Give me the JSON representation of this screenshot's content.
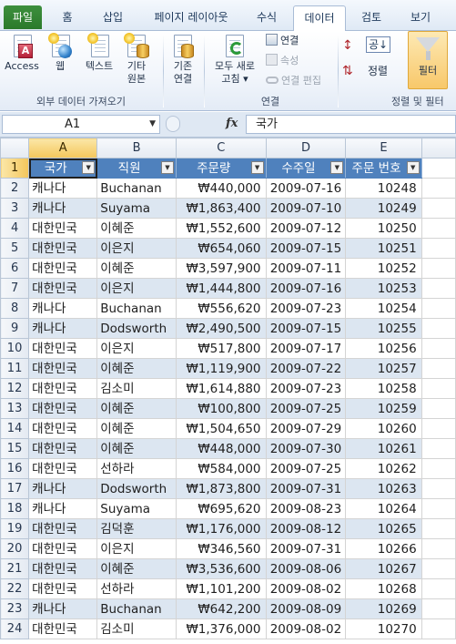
{
  "ribbon_tabs": [
    {
      "label": "파일"
    },
    {
      "label": "홈"
    },
    {
      "label": "삽입"
    },
    {
      "label": "페이지 레이아웃"
    },
    {
      "label": "수식"
    },
    {
      "label": "데이터"
    },
    {
      "label": "검토"
    },
    {
      "label": "보기"
    }
  ],
  "external_group": {
    "access": "Access",
    "web": "웹",
    "text": "텍스트",
    "other_line1": "기타",
    "other_line2": "원본",
    "label": "외부 데이터 가져오기"
  },
  "connections_group": {
    "existing_line1": "기존",
    "existing_line2": "연결",
    "refresh_line1": "모두 새로",
    "refresh_line2": "고침",
    "connections": "연결",
    "properties": "속성",
    "edit_links": "연결 편집",
    "label": "연결"
  },
  "sort_group": {
    "sort_az": "공↓",
    "sort": "정렬",
    "filter": "필터",
    "label": "정렬 및 필터"
  },
  "formula_bar": {
    "name_box": "A1",
    "fx": "fx",
    "formula": "국가"
  },
  "columns": [
    "A",
    "B",
    "C",
    "D",
    "E"
  ],
  "header_row": {
    "number": "1",
    "cells": [
      "국가",
      "직원",
      "주문량",
      "수주일",
      "주문 번호"
    ]
  },
  "rows": [
    {
      "n": "2",
      "c": [
        "캐나다",
        "Buchanan",
        "₩440,000",
        "2009-07-16",
        "10248"
      ]
    },
    {
      "n": "3",
      "c": [
        "캐나다",
        "Suyama",
        "₩1,863,400",
        "2009-07-10",
        "10249"
      ]
    },
    {
      "n": "4",
      "c": [
        "대한민국",
        "이혜준",
        "₩1,552,600",
        "2009-07-12",
        "10250"
      ]
    },
    {
      "n": "5",
      "c": [
        "대한민국",
        "이은지",
        "₩654,060",
        "2009-07-15",
        "10251"
      ]
    },
    {
      "n": "6",
      "c": [
        "대한민국",
        "이혜준",
        "₩3,597,900",
        "2009-07-11",
        "10252"
      ]
    },
    {
      "n": "7",
      "c": [
        "대한민국",
        "이은지",
        "₩1,444,800",
        "2009-07-16",
        "10253"
      ]
    },
    {
      "n": "8",
      "c": [
        "캐나다",
        "Buchanan",
        "₩556,620",
        "2009-07-23",
        "10254"
      ]
    },
    {
      "n": "9",
      "c": [
        "캐나다",
        "Dodsworth",
        "₩2,490,500",
        "2009-07-15",
        "10255"
      ]
    },
    {
      "n": "10",
      "c": [
        "대한민국",
        "이은지",
        "₩517,800",
        "2009-07-17",
        "10256"
      ]
    },
    {
      "n": "11",
      "c": [
        "대한민국",
        "이혜준",
        "₩1,119,900",
        "2009-07-22",
        "10257"
      ]
    },
    {
      "n": "12",
      "c": [
        "대한민국",
        "김소미",
        "₩1,614,880",
        "2009-07-23",
        "10258"
      ]
    },
    {
      "n": "13",
      "c": [
        "대한민국",
        "이혜준",
        "₩100,800",
        "2009-07-25",
        "10259"
      ]
    },
    {
      "n": "14",
      "c": [
        "대한민국",
        "이혜준",
        "₩1,504,650",
        "2009-07-29",
        "10260"
      ]
    },
    {
      "n": "15",
      "c": [
        "대한민국",
        "이혜준",
        "₩448,000",
        "2009-07-30",
        "10261"
      ]
    },
    {
      "n": "16",
      "c": [
        "대한민국",
        "선하라",
        "₩584,000",
        "2009-07-25",
        "10262"
      ]
    },
    {
      "n": "17",
      "c": [
        "캐나다",
        "Dodsworth",
        "₩1,873,800",
        "2009-07-31",
        "10263"
      ]
    },
    {
      "n": "18",
      "c": [
        "캐나다",
        "Suyama",
        "₩695,620",
        "2009-08-23",
        "10264"
      ]
    },
    {
      "n": "19",
      "c": [
        "대한민국",
        "김덕훈",
        "₩1,176,000",
        "2009-08-12",
        "10265"
      ]
    },
    {
      "n": "20",
      "c": [
        "대한민국",
        "이은지",
        "₩346,560",
        "2009-07-31",
        "10266"
      ]
    },
    {
      "n": "21",
      "c": [
        "대한민국",
        "이혜준",
        "₩3,536,600",
        "2009-08-06",
        "10267"
      ]
    },
    {
      "n": "22",
      "c": [
        "대한민국",
        "선하라",
        "₩1,101,200",
        "2009-08-02",
        "10268"
      ]
    },
    {
      "n": "23",
      "c": [
        "캐나다",
        "Buchanan",
        "₩642,200",
        "2009-08-09",
        "10269"
      ]
    },
    {
      "n": "24",
      "c": [
        "대한민국",
        "김소미",
        "₩1,376,000",
        "2009-08-02",
        "10270"
      ]
    }
  ]
}
